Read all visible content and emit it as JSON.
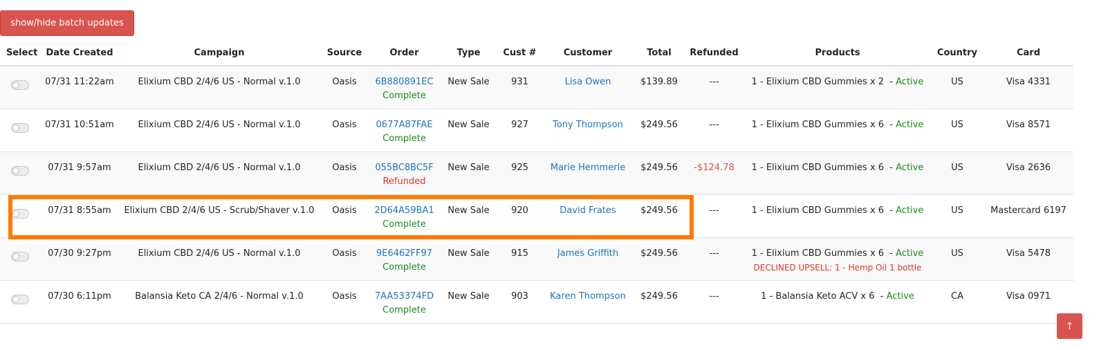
{
  "batch_button_label": "show/hide batch updates",
  "scroll_top_icon": "↑",
  "colors": {
    "accent_red": "#d9534f",
    "link_blue": "#1e73be",
    "status_green": "#1b8a1b",
    "highlight_orange": "#ff7a00"
  },
  "table": {
    "headers": [
      "Select",
      "Date Created",
      "Campaign",
      "Source",
      "Order",
      "Type",
      "Cust #",
      "Customer",
      "Total",
      "Refunded",
      "Products",
      "Country",
      "Card"
    ],
    "rows": [
      {
        "date": "07/31 11:22am",
        "campaign": "Elixium CBD 2/4/6 US - Normal v.1.0",
        "source": "Oasis",
        "order_id": "6B880891EC",
        "order_status": "Complete",
        "type": "New Sale",
        "cust_num": "931",
        "customer": "Lisa Owen",
        "total": "$139.89",
        "refunded": "---",
        "product": "1 - Elixium CBD Gummies x 2",
        "product_status": "Active",
        "declined_upsell": "",
        "country": "US",
        "card": "Visa 4331"
      },
      {
        "date": "07/31 10:51am",
        "campaign": "Elixium CBD 2/4/6 US - Normal v.1.0",
        "source": "Oasis",
        "order_id": "0677A87FAE",
        "order_status": "Complete",
        "type": "New Sale",
        "cust_num": "927",
        "customer": "Tony Thompson",
        "total": "$249.56",
        "refunded": "---",
        "product": "1 - Elixium CBD Gummies x 6",
        "product_status": "Active",
        "declined_upsell": "",
        "country": "US",
        "card": "Visa 8571"
      },
      {
        "date": "07/31 9:57am",
        "campaign": "Elixium CBD 2/4/6 US - Normal v.1.0",
        "source": "Oasis",
        "order_id": "055BC8BC5F",
        "order_status": "Refunded",
        "type": "New Sale",
        "cust_num": "925",
        "customer": "Marie Hemmerle",
        "total": "$249.56",
        "refunded": "-$124.78",
        "product": "1 - Elixium CBD Gummies x 6",
        "product_status": "Active",
        "declined_upsell": "",
        "country": "US",
        "card": "Visa 2636"
      },
      {
        "date": "07/31 8:55am",
        "campaign": "Elixium CBD 2/4/6 US - Scrub/Shaver v.1.0",
        "source": "Oasis",
        "order_id": "2D64A59BA1",
        "order_status": "Complete",
        "type": "New Sale",
        "cust_num": "920",
        "customer": "David Frates",
        "total": "$249.56",
        "refunded": "---",
        "product": "1 - Elixium CBD Gummies x 6",
        "product_status": "Active",
        "declined_upsell": "",
        "country": "US",
        "card": "Mastercard 6197"
      },
      {
        "date": "07/30 9:27pm",
        "campaign": "Elixium CBD 2/4/6 US - Normal v.1.0",
        "source": "Oasis",
        "order_id": "9E6462FF97",
        "order_status": "Complete",
        "type": "New Sale",
        "cust_num": "915",
        "customer": "James Griffith",
        "total": "$249.56",
        "refunded": "---",
        "product": "1 - Elixium CBD Gummies x 6",
        "product_status": "Active",
        "declined_upsell": "DECLINED UPSELL: 1 - Hemp Oil  1 bottle",
        "country": "US",
        "card": "Visa 5478"
      },
      {
        "date": "07/30 6:11pm",
        "campaign": "Balansia Keto CA 2/4/6 - Normal v.1.0",
        "source": "Oasis",
        "order_id": "7AA53374FD",
        "order_status": "Complete",
        "type": "New Sale",
        "cust_num": "903",
        "customer": "Karen Thompson",
        "total": "$249.56",
        "refunded": "---",
        "product": "1 - Balansia Keto ACV x 6",
        "product_status": "Active",
        "declined_upsell": "",
        "country": "CA",
        "card": "Visa 0971"
      }
    ]
  }
}
